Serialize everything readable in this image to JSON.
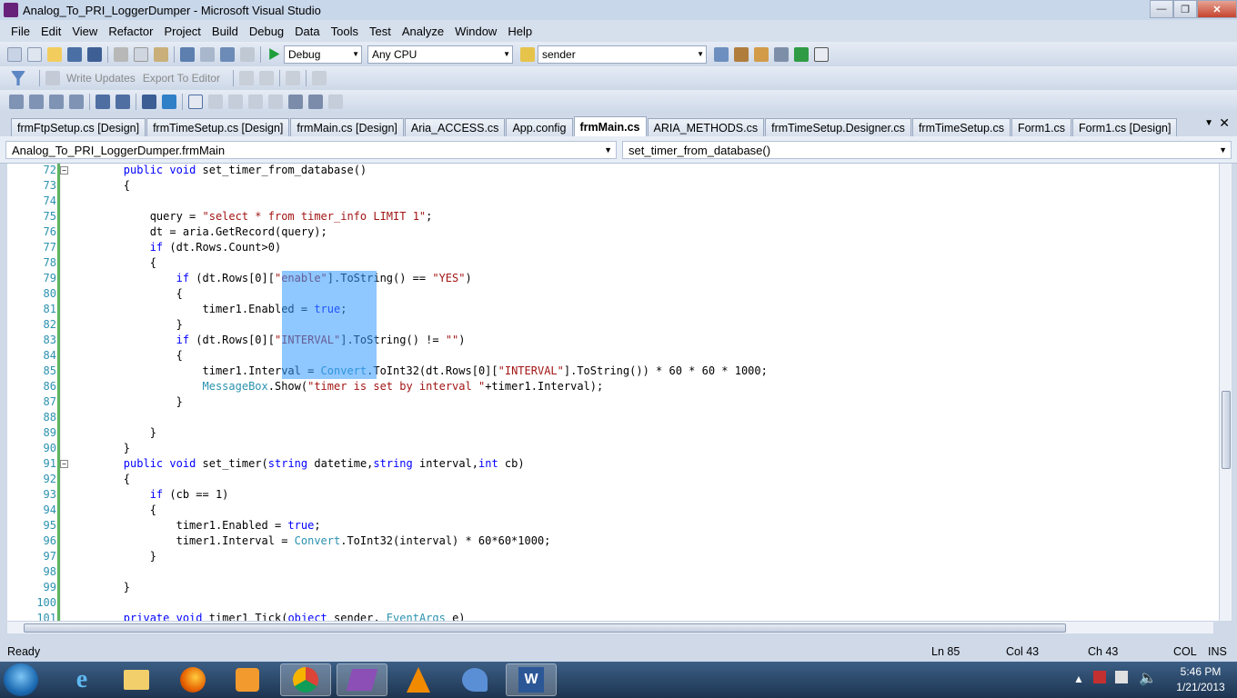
{
  "window": {
    "title": "Analog_To_PRI_LoggerDumper - Microsoft Visual Studio"
  },
  "menu": [
    "File",
    "Edit",
    "View",
    "Refactor",
    "Project",
    "Build",
    "Debug",
    "Data",
    "Tools",
    "Test",
    "Analyze",
    "Window",
    "Help"
  ],
  "toolbar": {
    "config": "Debug",
    "platform": "Any CPU",
    "find": "sender",
    "write_updates": "Write Updates",
    "export_to_editor": "Export To Editor"
  },
  "tabs": [
    "frmFtpSetup.cs [Design]",
    "frmTimeSetup.cs [Design]",
    "frmMain.cs [Design]",
    "Aria_ACCESS.cs",
    "App.config",
    "frmMain.cs",
    "ARIA_METHODS.cs",
    "frmTimeSetup.Designer.cs",
    "frmTimeSetup.cs",
    "Form1.cs",
    "Form1.cs [Design]"
  ],
  "active_tab": "frmMain.cs",
  "nav": {
    "class": "Analog_To_PRI_LoggerDumper.frmMain",
    "member": "set_timer_from_database()"
  },
  "code": [
    {
      "n": "72",
      "t": "        public void set_timer_from_database()"
    },
    {
      "n": "73",
      "t": "        {"
    },
    {
      "n": "74",
      "t": ""
    },
    {
      "n": "75",
      "t": "            query = \"select * from timer_info LIMIT 1\";"
    },
    {
      "n": "76",
      "t": "            dt = aria.GetRecord(query);"
    },
    {
      "n": "77",
      "t": "            if (dt.Rows.Count>0)"
    },
    {
      "n": "78",
      "t": "            {"
    },
    {
      "n": "79",
      "t": "                if (dt.Rows[0][\"enable\"].ToString() == \"YES\")"
    },
    {
      "n": "80",
      "t": "                {"
    },
    {
      "n": "81",
      "t": "                    timer1.Enabled = true;"
    },
    {
      "n": "82",
      "t": "                }"
    },
    {
      "n": "83",
      "t": "                if (dt.Rows[0][\"INTERVAL\"].ToString() != \"\")"
    },
    {
      "n": "84",
      "t": "                {"
    },
    {
      "n": "85",
      "t": "                    timer1.Interval = Convert.ToInt32(dt.Rows[0][\"INTERVAL\"].ToString()) * 60 * 60 * 1000;"
    },
    {
      "n": "86",
      "t": "                    MessageBox.Show(\"timer is set by interval \"+timer1.Interval);"
    },
    {
      "n": "87",
      "t": "                }"
    },
    {
      "n": "88",
      "t": ""
    },
    {
      "n": "89",
      "t": "            }"
    },
    {
      "n": "90",
      "t": "        }"
    },
    {
      "n": "91",
      "t": "        public void set_timer(string datetime,string interval,int cb)"
    },
    {
      "n": "92",
      "t": "        {"
    },
    {
      "n": "93",
      "t": "            if (cb == 1)"
    },
    {
      "n": "94",
      "t": "            {"
    },
    {
      "n": "95",
      "t": "                timer1.Enabled = true;"
    },
    {
      "n": "96",
      "t": "                timer1.Interval = Convert.ToInt32(interval) * 60*60*1000;"
    },
    {
      "n": "97",
      "t": "            }"
    },
    {
      "n": "98",
      "t": ""
    },
    {
      "n": "99",
      "t": "        }"
    },
    {
      "n": "100",
      "t": ""
    },
    {
      "n": "101",
      "t": "        private void timer1_Tick(object sender, EventArgs e)"
    }
  ],
  "status": {
    "left": "Ready",
    "ln": "Ln 85",
    "col": "Col 43",
    "ch": "Ch 43",
    "col_mode": "COL",
    "ins": "INS"
  },
  "clock": {
    "time": "5:46 PM",
    "date": "1/21/2013"
  },
  "taskbar": [
    "internet-explorer-icon",
    "file-explorer-icon",
    "firefox-icon",
    "media-player-icon",
    "chrome-icon",
    "visual-studio-icon",
    "vlc-icon",
    "dolphin-icon",
    "word-icon"
  ]
}
